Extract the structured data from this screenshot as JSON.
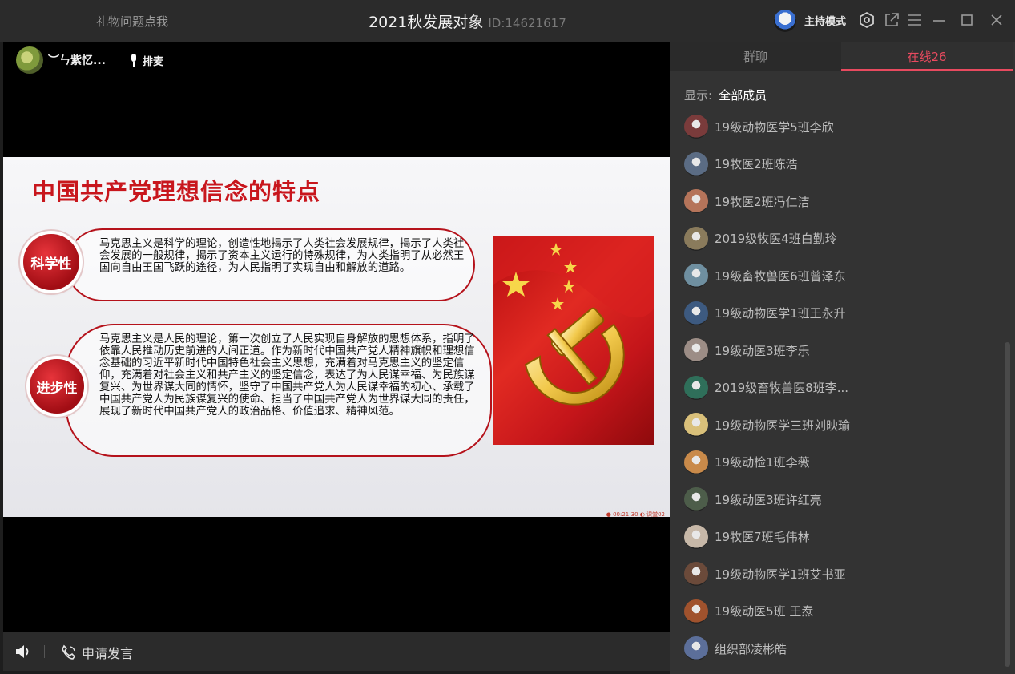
{
  "titlebar": {
    "gift_link": "礼物问题点我",
    "room_title": "2021秋发展对象",
    "room_id": "ID:14621617",
    "mode_label": "主持模式"
  },
  "presenter": {
    "name": "︶ㄣ紫忆...",
    "mic_label": "排麦"
  },
  "slide": {
    "title": "中国共产党理想信念的特点",
    "items": [
      {
        "badge": "科学性",
        "text": "马克思主义是科学的理论，创造性地揭示了人类社会发展规律，揭示了人类社会发展的一般规律，揭示了资本主义运行的特殊规律，为人类指明了从必然王国向自由王国飞跃的途径，为人民指明了实现自由和解放的道路。"
      },
      {
        "badge": "进步性",
        "text": "马克思主义是人民的理论，第一次创立了人民实现自身解放的思想体系，指明了依靠人民推动历史前进的人间正道。作为新时代中国共产党人精神旗帜和理想信念基础的习近平新时代中国特色社会主义思想，充满着对马克思主义的坚定信仰，充满着对社会主义和共产主义的坚定信念，表达了为人民谋幸福、为民族谋复兴、为世界谋大同的情怀，坚守了中国共产党人为人民谋幸福的初心、承载了中国共产党人为民族谋复兴的使命、担当了中国共产党人为世界谋大同的责任，展现了新时代中国共产党人的政治品格、价值追求、精神风范。"
      }
    ],
    "footer": "● 00:21:30  ◐ 课堂02"
  },
  "bottombar": {
    "apply_label": "申请发言"
  },
  "panel": {
    "tabs": [
      "群聊",
      "在线26"
    ],
    "filter_label": "显示:",
    "filter_value": "全部成员",
    "members": [
      {
        "name": "19级动物医学5班李欣",
        "color": "#7a3b3b"
      },
      {
        "name": "19牧医2班陈浩",
        "color": "#5b6c84"
      },
      {
        "name": "19牧医2班冯仁洁",
        "color": "#b5745a"
      },
      {
        "name": "2019级牧医4班白勤玲",
        "color": "#8a7b5c"
      },
      {
        "name": "19级畜牧兽医6班曾泽东",
        "color": "#6f8fa0"
      },
      {
        "name": "19级动物医学1班王永升",
        "color": "#3d5a80"
      },
      {
        "name": "19级动医3班李乐",
        "color": "#9c8d86"
      },
      {
        "name": "2019级畜牧兽医8班李...",
        "color": "#2f6f5a"
      },
      {
        "name": "19级动物医学三班刘映瑜",
        "color": "#d9c07a"
      },
      {
        "name": "19级动检1班李薇",
        "color": "#c98a4a"
      },
      {
        "name": "19级动医3班许红亮",
        "color": "#4d5d4a"
      },
      {
        "name": "19牧医7班毛伟林",
        "color": "#c7b8a8"
      },
      {
        "name": "19级动物医学1班艾书亚",
        "color": "#6b4a3a"
      },
      {
        "name": "19级动医5班 王焘",
        "color": "#a0522d"
      },
      {
        "name": "组织部凌彬皓",
        "color": "#5c6f9a"
      }
    ]
  }
}
